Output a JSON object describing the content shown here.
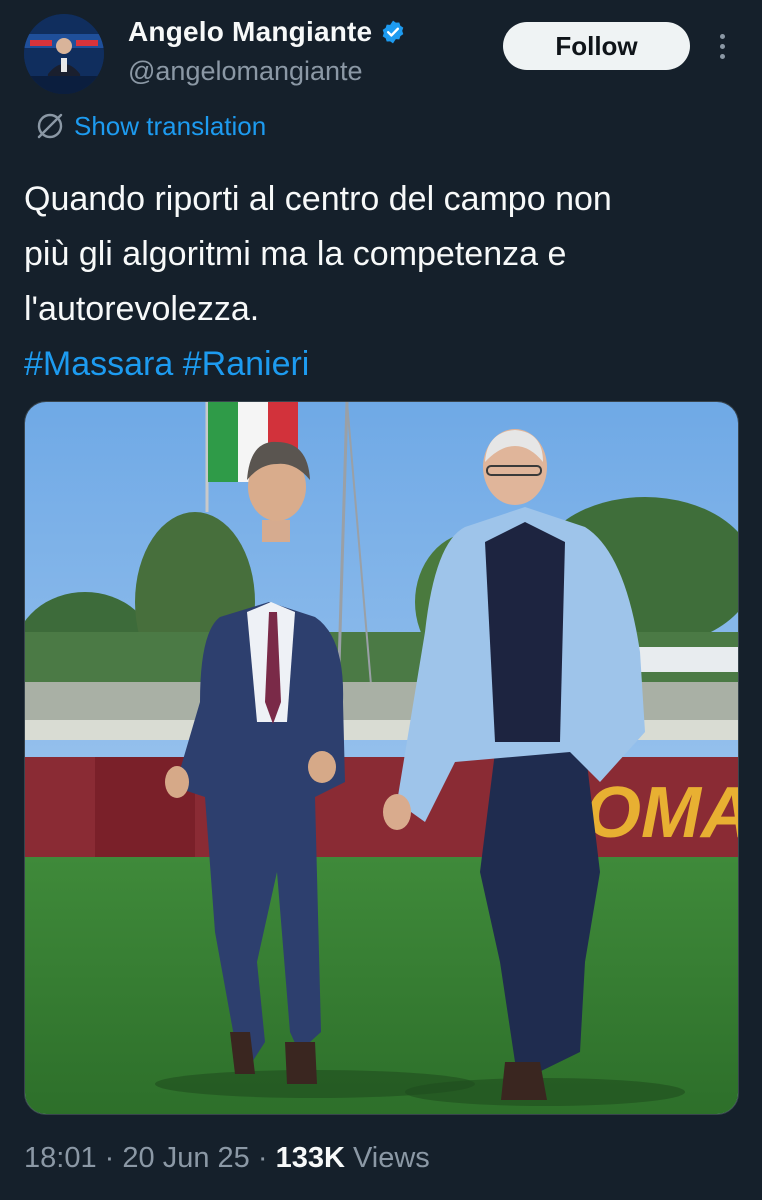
{
  "author": {
    "display_name": "Angelo Mangiante",
    "handle": "@angelomangiante",
    "verified_icon": "verified-badge-icon",
    "follow_label": "Follow",
    "more_icon": "more-vertical-icon"
  },
  "translation": {
    "icon": "globe-slash-icon",
    "label": "Show translation"
  },
  "tweet": {
    "lines": [
      "Quando riporti al centro del campo non",
      "più gli algoritmi ma la competenza e",
      "l'autorevolezza."
    ],
    "hashtags": [
      "#Massara",
      "#Ranieri"
    ],
    "media_description": "Two men in suits walking on a football pitch",
    "banner_text": "OMA"
  },
  "meta": {
    "time": "18:01",
    "sep1": "·",
    "date": "20 Jun 25",
    "sep2": "·",
    "views_count": "133K",
    "views_label": "Views"
  },
  "colors": {
    "background": "#15202b",
    "text": "#f7f9f9",
    "secondary": "#8b98a5",
    "accent": "#1d9bf0",
    "follow_bg": "#eff3f4"
  }
}
